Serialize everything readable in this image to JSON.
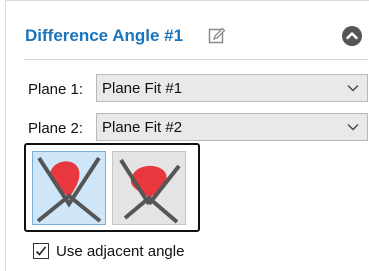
{
  "panel": {
    "title": "Difference Angle #1",
    "edit_icon": "edit-icon",
    "collapse_icon": "chevron-up-icon"
  },
  "plane1": {
    "label": "Plane 1:",
    "value": "Plane Fit #1"
  },
  "plane2": {
    "label": "Plane 2:",
    "value": "Plane Fit #2"
  },
  "angle_modes": {
    "selected": "mode-1",
    "buttons": [
      "mode-1",
      "mode-2"
    ],
    "accent_color": "#e8383d",
    "selected_bg": "#cfe6f9"
  },
  "options": {
    "use_adjacent_label": "Use adjacent angle",
    "use_adjacent_checked": true
  },
  "colors": {
    "title": "#1b75bc"
  }
}
